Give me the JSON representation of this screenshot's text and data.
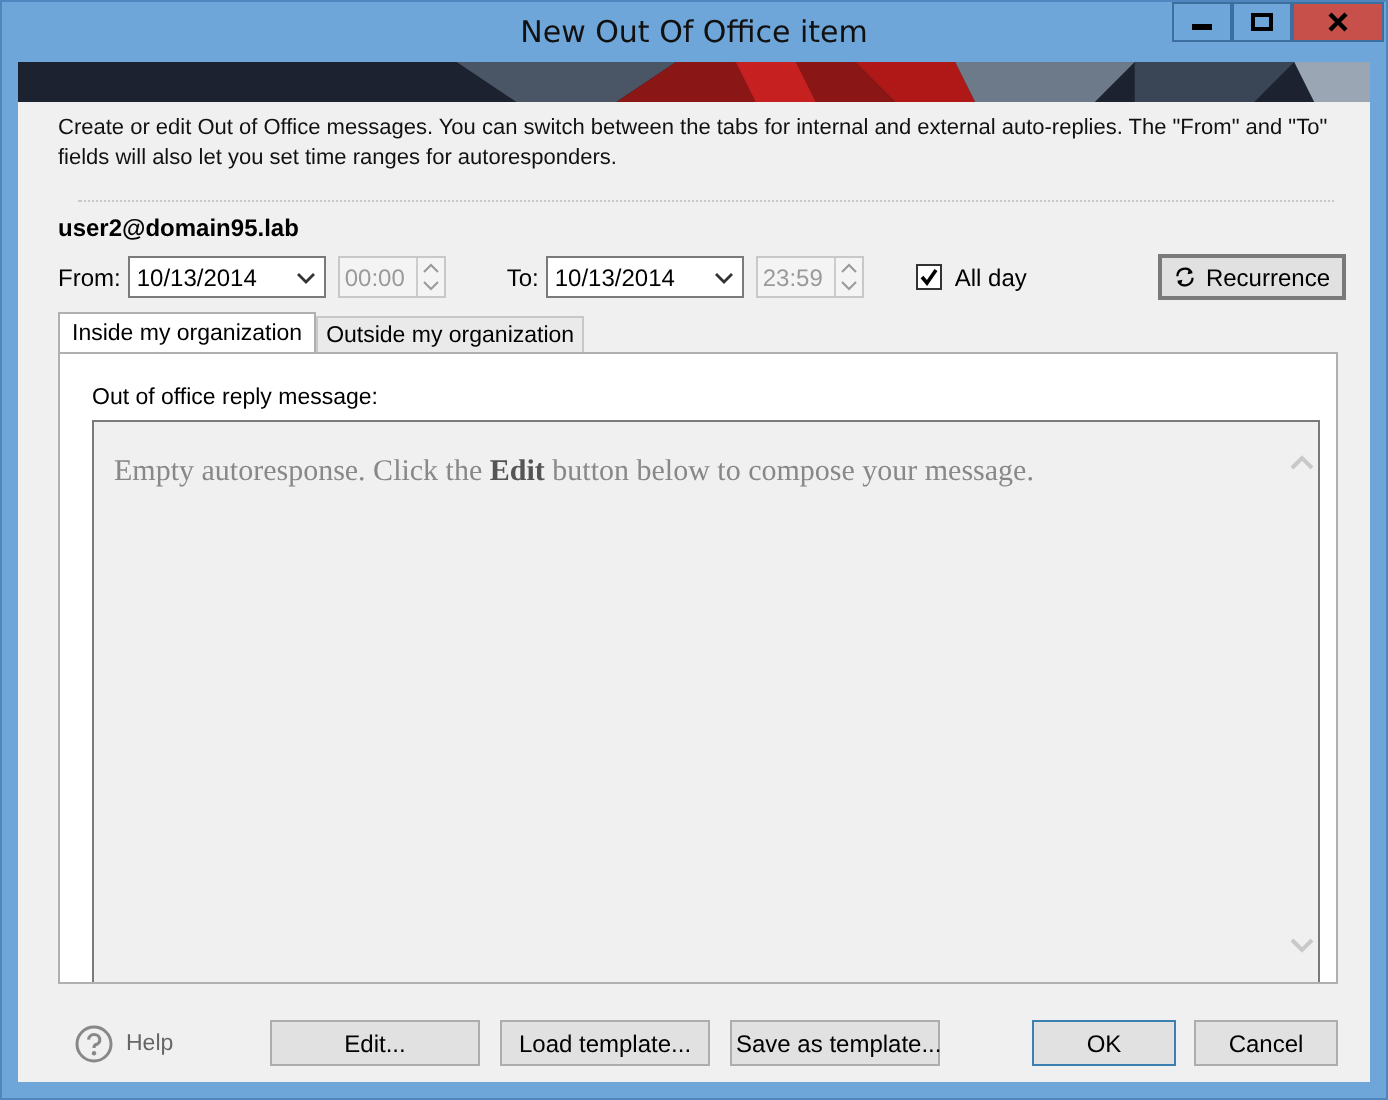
{
  "window": {
    "title": "New Out Of Office item"
  },
  "description": "Create or edit Out of Office messages. You can switch between the tabs for internal and external auto-replies. The \"From\" and \"To\" fields will also let you set time ranges for autoresponders.",
  "user": "user2@domain95.lab",
  "range": {
    "from_label": "From:",
    "from_date": "10/13/2014",
    "from_time": "00:00",
    "from_time_disabled": true,
    "to_label": "To:",
    "to_date": "10/13/2014",
    "to_time": "23:59",
    "to_time_disabled": true,
    "all_day": {
      "label": "All day",
      "checked": true
    },
    "recurrence": "Recurrence"
  },
  "tabs": [
    {
      "label": "Inside my organization",
      "selected": true
    },
    {
      "label": "Outside my organization",
      "selected": false
    }
  ],
  "message_label": "Out of office reply message:",
  "message": "Empty autoresponse. Click the **Edit** button below to compose your message.",
  "help": "Help",
  "buttons": [
    {
      "label": "Edit...",
      "kind": "action"
    },
    {
      "label": "Load template...",
      "kind": "action"
    },
    {
      "label": "Save as template...",
      "kind": "action"
    },
    {
      "label": "OK",
      "kind": "default"
    },
    {
      "label": "Cancel",
      "kind": "dialog"
    }
  ]
}
